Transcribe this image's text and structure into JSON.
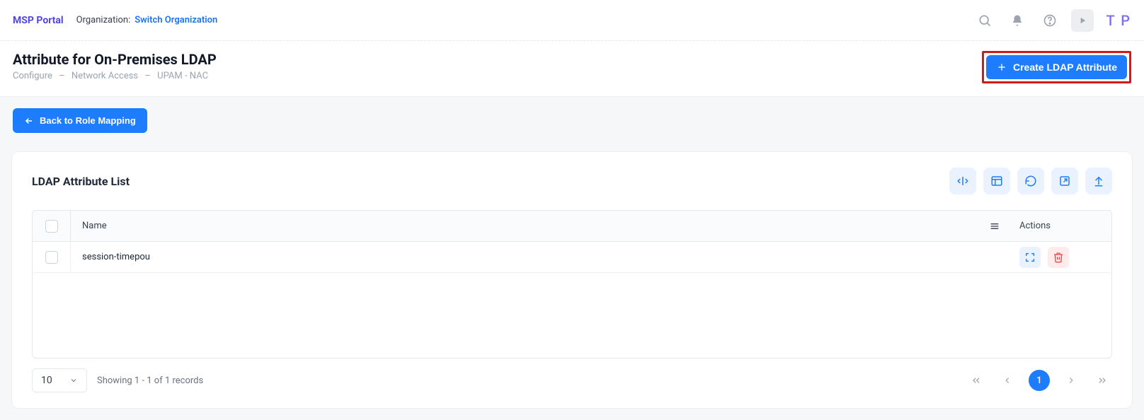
{
  "topbar": {
    "brand": "MSP Portal",
    "org_label": "Organization:",
    "org_link": "Switch Organization",
    "avatar_initials": "T P"
  },
  "header": {
    "title": "Attribute for On-Premises LDAP",
    "breadcrumb": [
      "Configure",
      "Network Access",
      "UPAM - NAC"
    ],
    "create_label": "Create LDAP Attribute"
  },
  "back_button": "Back to Role Mapping",
  "card": {
    "title": "LDAP Attribute List",
    "columns": {
      "name": "Name",
      "actions": "Actions"
    },
    "rows": [
      {
        "name": "session-timepou"
      }
    ],
    "page_size": "10",
    "records_text": "Showing 1 - 1 of 1 records",
    "current_page": "1"
  }
}
